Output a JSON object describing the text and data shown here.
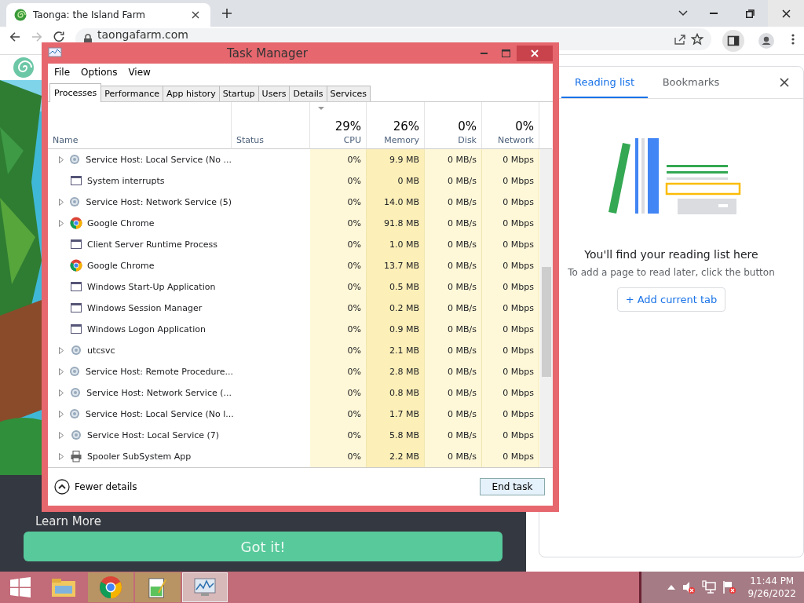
{
  "browser": {
    "tab": {
      "title": "Taonga: the Island Farm"
    },
    "address": "taongafarm.com"
  },
  "page": {
    "learn_more": "Learn More",
    "button": "Got it!"
  },
  "side_panel": {
    "tabs": [
      {
        "label": "Reading list",
        "selected": true
      },
      {
        "label": "Bookmarks",
        "selected": false
      }
    ],
    "heading": "You'll find your reading list here",
    "hint": "To add a page to read later, click the button",
    "button": "+ Add current tab"
  },
  "task_manager": {
    "title": "Task Manager",
    "menu": [
      "File",
      "Options",
      "View"
    ],
    "tabs": [
      {
        "label": "Processes",
        "selected": true
      },
      {
        "label": "Performance",
        "selected": false
      },
      {
        "label": "App history",
        "selected": false
      },
      {
        "label": "Startup",
        "selected": false
      },
      {
        "label": "Users",
        "selected": false
      },
      {
        "label": "Details",
        "selected": false
      },
      {
        "label": "Services",
        "selected": false
      }
    ],
    "columns": [
      {
        "label": "Name"
      },
      {
        "label": "Status"
      },
      {
        "label": "CPU",
        "total": "29%"
      },
      {
        "label": "Memory",
        "total": "26%"
      },
      {
        "label": "Disk",
        "total": "0%"
      },
      {
        "label": "Network",
        "total": "0%"
      }
    ],
    "rows": [
      {
        "name": "Service Host: Local Service (No ...",
        "kind": "gear",
        "expandable": true,
        "cpu": "0%",
        "memory": "9.9 MB",
        "disk": "0 MB/s",
        "network": "0 Mbps"
      },
      {
        "name": "System interrupts",
        "kind": "window",
        "expandable": false,
        "cpu": "0%",
        "memory": "0 MB",
        "disk": "0 MB/s",
        "network": "0 Mbps"
      },
      {
        "name": "Service Host: Network Service (5)",
        "kind": "gear",
        "expandable": true,
        "cpu": "0%",
        "memory": "14.0 MB",
        "disk": "0 MB/s",
        "network": "0 Mbps"
      },
      {
        "name": "Google Chrome",
        "kind": "chrome",
        "expandable": true,
        "cpu": "0%",
        "memory": "91.8 MB",
        "disk": "0 MB/s",
        "network": "0 Mbps"
      },
      {
        "name": "Client Server Runtime Process",
        "kind": "window",
        "expandable": false,
        "cpu": "0%",
        "memory": "1.0 MB",
        "disk": "0 MB/s",
        "network": "0 Mbps"
      },
      {
        "name": "Google Chrome",
        "kind": "chrome",
        "expandable": false,
        "cpu": "0%",
        "memory": "13.7 MB",
        "disk": "0 MB/s",
        "network": "0 Mbps"
      },
      {
        "name": "Windows Start-Up Application",
        "kind": "window",
        "expandable": false,
        "cpu": "0%",
        "memory": "0.5 MB",
        "disk": "0 MB/s",
        "network": "0 Mbps"
      },
      {
        "name": "Windows Session Manager",
        "kind": "window",
        "expandable": false,
        "cpu": "0%",
        "memory": "0.2 MB",
        "disk": "0 MB/s",
        "network": "0 Mbps"
      },
      {
        "name": "Windows Logon Application",
        "kind": "window",
        "expandable": false,
        "cpu": "0%",
        "memory": "0.9 MB",
        "disk": "0 MB/s",
        "network": "0 Mbps"
      },
      {
        "name": "utcsvc",
        "kind": "gear",
        "expandable": true,
        "cpu": "0%",
        "memory": "2.1 MB",
        "disk": "0 MB/s",
        "network": "0 Mbps"
      },
      {
        "name": "Service Host: Remote Procedure...",
        "kind": "gear",
        "expandable": true,
        "cpu": "0%",
        "memory": "2.8 MB",
        "disk": "0 MB/s",
        "network": "0 Mbps"
      },
      {
        "name": "Service Host: Network Service (...",
        "kind": "gear",
        "expandable": true,
        "cpu": "0%",
        "memory": "0.8 MB",
        "disk": "0 MB/s",
        "network": "0 Mbps"
      },
      {
        "name": "Service Host: Local Service (No l...",
        "kind": "gear",
        "expandable": true,
        "cpu": "0%",
        "memory": "1.7 MB",
        "disk": "0 MB/s",
        "network": "0 Mbps"
      },
      {
        "name": "Service Host: Local Service (7)",
        "kind": "gear",
        "expandable": true,
        "cpu": "0%",
        "memory": "5.8 MB",
        "disk": "0 MB/s",
        "network": "0 Mbps"
      },
      {
        "name": "Spooler SubSystem App",
        "kind": "printer",
        "expandable": true,
        "cpu": "0%",
        "memory": "2.2 MB",
        "disk": "0 MB/s",
        "network": "0 Mbps"
      }
    ],
    "fewer_details": "Fewer details",
    "end_task": "End task"
  },
  "taskbar": {
    "apps": [
      {
        "kind": "explorer",
        "selected": false
      },
      {
        "kind": "chrome",
        "selected": false
      },
      {
        "kind": "notepad",
        "selected": false
      },
      {
        "kind": "taskmgr",
        "selected": true
      }
    ],
    "time": "11:44 PM",
    "date": "9/26/2022"
  }
}
